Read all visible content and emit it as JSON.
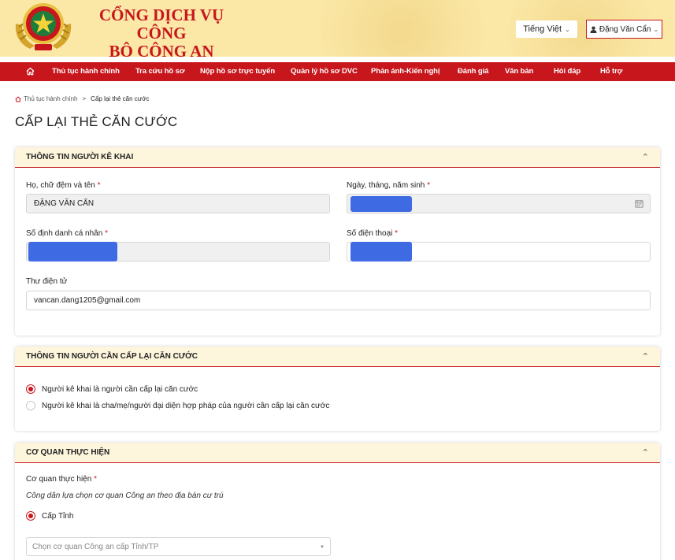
{
  "header": {
    "title_line1": "CỔNG DỊCH VỤ CÔNG",
    "title_line2": "BỘ CÔNG AN",
    "language": "Tiếng Việt",
    "user": "Đặng Văn Cẩn",
    "brand_color": "#c8161d",
    "header_bg": "#fbe7a6"
  },
  "nav": {
    "home_icon": "home-icon",
    "items": [
      "Thủ tục hành chính",
      "Tra cứu hồ sơ",
      "Nộp hồ sơ trực tuyến",
      "Quản lý hồ sơ DVC",
      "Phản ánh-Kiến nghị",
      "Đánh giá",
      "Văn bản",
      "Hỏi đáp",
      "Hỗ trợ"
    ]
  },
  "breadcrumb": {
    "home": "Thủ tục hành chính",
    "separator": ">",
    "current": "Cấp lại thẻ căn cước"
  },
  "page_title": "CẤP LẠI THẺ CĂN CƯỚC",
  "section1": {
    "title": "THÔNG TIN NGƯỜI KÊ KHAI",
    "name_label": "Họ, chữ đệm và tên",
    "name_value": "ĐẶNG VĂN CẨN",
    "dob_label": "Ngày, tháng, năm sinh",
    "id_label": "Số định danh cá nhân",
    "phone_label": "Số điện thoại",
    "email_label": "Thư điện tử",
    "email_value": "vancan.dang1205@gmail.com",
    "required_mark": "*"
  },
  "section2": {
    "title": "THÔNG TIN NGƯỜI CẦN CẤP LẠI CĂN CƯỚC",
    "option1": "Người kê khai là người cần cấp lại căn cước",
    "option2": "Người kê khai là cha/mẹ/người đại diện hợp pháp của người cần cấp lại căn cước",
    "selected": 1
  },
  "section3": {
    "title": "CƠ QUAN THỰC HIỆN",
    "agency_label": "Cơ quan thực hiện",
    "hint": "Công dân lựa chọn cơ quan Công an theo địa bàn cư trú",
    "level_option": "Cấp Tỉnh",
    "select_placeholder": "Chọn cơ quan Công an cấp Tỉnh/TP"
  }
}
